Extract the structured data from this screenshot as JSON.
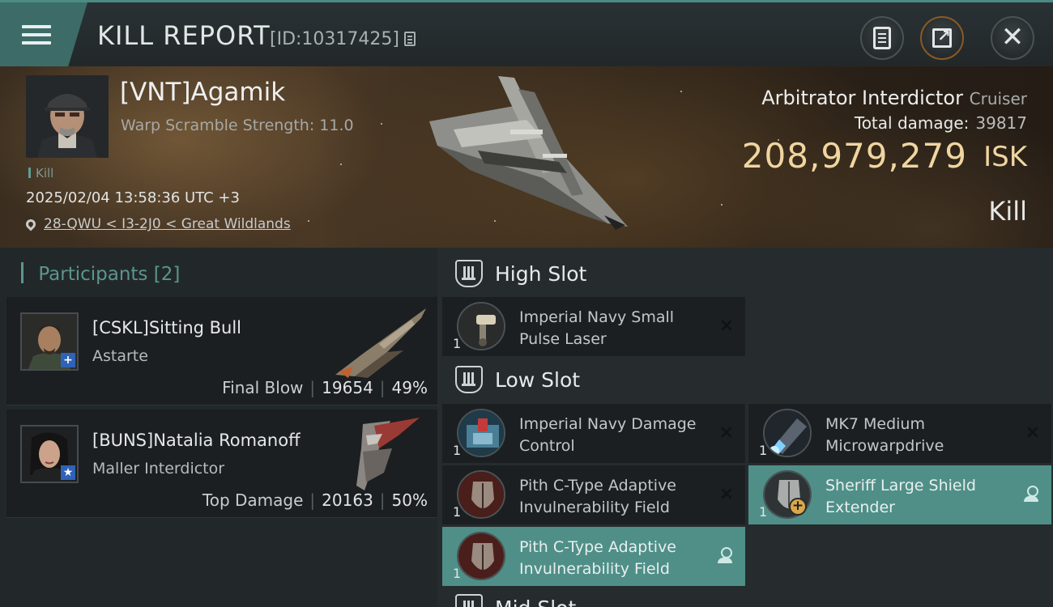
{
  "header": {
    "title": "KILL REPORT",
    "report_id": "[ID:10317425]"
  },
  "victim": {
    "name": "[VNT]Agamik",
    "warp_scramble": "Warp Scramble Strength: 11.0",
    "tag": "Kill",
    "time": "2025/02/04 13:58:36 UTC +3",
    "location": "28-QWU < I3-2J0 < Great Wildlands",
    "ship_name": "Arbitrator Interdictor",
    "ship_class": "Cruiser",
    "total_damage_label": "Total damage:",
    "total_damage": "39817",
    "isk_value": "208,979,279",
    "isk_unit": "ISK",
    "result": "Kill"
  },
  "participants": {
    "label": "Participants",
    "count": "[2]",
    "items": [
      {
        "name": "[CSKL]Sitting Bull",
        "ship": "Astarte",
        "role": "Final Blow",
        "damage": "19654",
        "percent": "49%",
        "badge": "+"
      },
      {
        "name": "[BUNS]Natalia Romanoff",
        "ship": "Maller Interdictor",
        "role": "Top Damage",
        "damage": "20163",
        "percent": "50%",
        "badge": "★"
      }
    ]
  },
  "fitting": {
    "high_slot_label": "High Slot",
    "low_slot_label": "Low Slot",
    "mid_slot_label": "Mid Slot",
    "modules": [
      {
        "name": "Imperial Navy Small Pulse Laser",
        "qty": "1",
        "action": "×"
      },
      {
        "name": "Imperial Navy Damage Control",
        "qty": "1",
        "action": "×"
      },
      {
        "name": "MK7 Medium Microwarpdrive",
        "qty": "1",
        "action": "×"
      },
      {
        "name": "Pith C-Type Adaptive Invulnerability Field",
        "qty": "1",
        "action": "×"
      },
      {
        "name": "Sheriff Large Shield Extender",
        "qty": "1",
        "action": "person"
      },
      {
        "name": "Pith C-Type Adaptive Invulnerability Field",
        "qty": "1",
        "action": "person"
      }
    ]
  },
  "colors": {
    "accent_teal": "#4f8f88",
    "isk_gold": "#f0d5a0"
  }
}
